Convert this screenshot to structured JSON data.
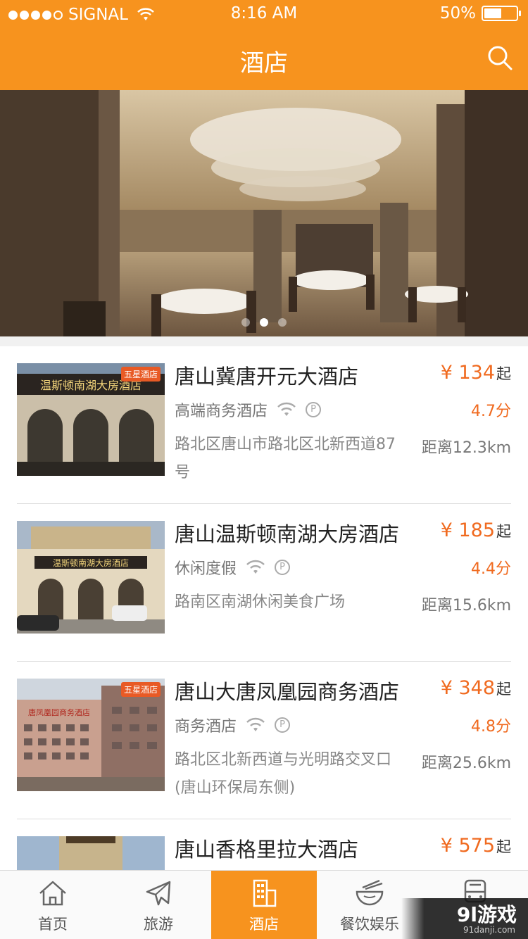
{
  "status_bar": {
    "carrier": "SIGNAL",
    "time": "8:16 AM",
    "battery": "50%"
  },
  "nav": {
    "title": "酒店"
  },
  "banner": {
    "pages": 3,
    "active_page": 2
  },
  "hotels": [
    {
      "name": "唐山冀唐开元大酒店",
      "price": "¥ 134",
      "price_suffix": "起",
      "type": "高端商务酒店",
      "score": "4.7分",
      "address": "路北区唐山市路北区北新西道87号",
      "distance": "距离12.3km",
      "badge": "五星酒店",
      "sign": "温斯顿南湖大房酒店"
    },
    {
      "name": "唐山温斯顿南湖大房酒店",
      "price": "¥ 185",
      "price_suffix": "起",
      "type": "休闲度假",
      "score": "4.4分",
      "address": "路南区南湖休闲美食广场",
      "distance": "距离15.6km",
      "badge": "",
      "sign": "温斯顿南湖大房酒店"
    },
    {
      "name": "唐山大唐凤凰园商务酒店",
      "price": "¥ 348",
      "price_suffix": "起",
      "type": "商务酒店",
      "score": "4.8分",
      "address": " 路北区北新西道与光明路交叉口(唐山环保局东侧)",
      "distance": "距离25.6km",
      "badge": "五星酒店",
      "sign": "唐凤凰园商务酒店"
    },
    {
      "name": "唐山香格里拉大酒店",
      "price": "¥ 575",
      "price_suffix": "起",
      "type": "",
      "score": "",
      "address": "",
      "distance": "",
      "badge": "",
      "sign": ""
    }
  ],
  "tabs": [
    {
      "label": "首页",
      "icon": "home-icon"
    },
    {
      "label": "旅游",
      "icon": "plane-icon"
    },
    {
      "label": "酒店",
      "icon": "building-icon"
    },
    {
      "label": "餐饮娱乐",
      "icon": "bowl-icon"
    },
    {
      "label": "",
      "icon": "bus-icon"
    }
  ],
  "watermark": {
    "main": "9l游戏",
    "sub": "91danji.com"
  },
  "colors": {
    "accent": "#f7931e",
    "price": "#f06a1f"
  }
}
